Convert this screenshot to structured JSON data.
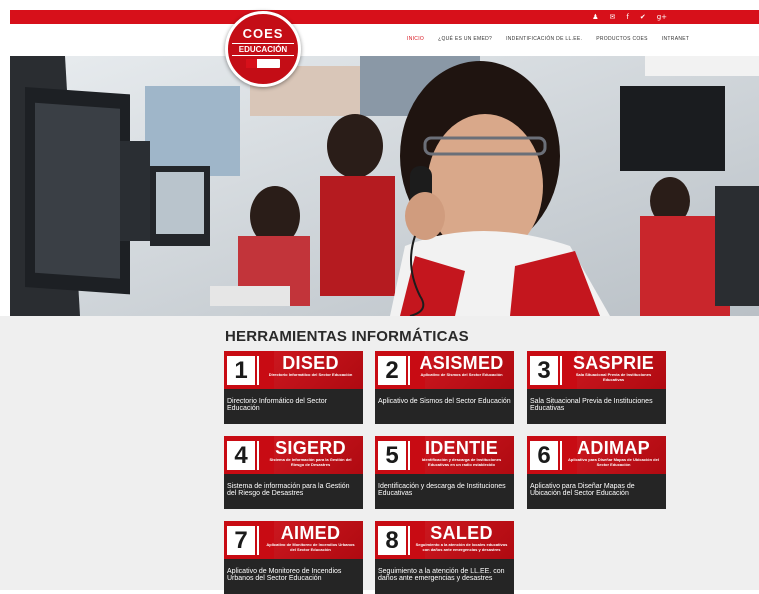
{
  "topbar": {
    "social_icons": [
      "user-icon",
      "mail-icon",
      "facebook-icon",
      "twitter-icon",
      "google-plus-icon"
    ],
    "glyphs": [
      "♟",
      "✉",
      "f",
      "✔",
      "g+"
    ]
  },
  "brand": {
    "logo_line1": "COES",
    "logo_line2": "EDUCACIÓN",
    "accent": "#d7101a"
  },
  "nav": [
    {
      "label": "INICIO",
      "active": true
    },
    {
      "label": "¿QUÉ ES UN EMED?",
      "active": false
    },
    {
      "label": "INDENTIFICACIÓN DE LL.EE.",
      "active": false
    },
    {
      "label": "PRODUCTOS COES",
      "active": false
    },
    {
      "label": "INTRANET",
      "active": false
    }
  ],
  "tools": {
    "title": "HERRAMIENTAS INFORMÁTICAS",
    "cards": [
      {
        "number": "1",
        "abbr": "DISED",
        "subtitle": "Directorio Informático del Sector Educación",
        "description": "Directorio Informático del Sector Educación"
      },
      {
        "number": "2",
        "abbr": "ASISMED",
        "subtitle": "Aplicativo de Sismos del Sector Educación",
        "description": "Aplicativo de Sismos del Sector Educación"
      },
      {
        "number": "3",
        "abbr": "SASPRIE",
        "subtitle": "Sala Situacional Previa de Instituciones Educativas",
        "description": "Sala Situacional Previa de Instituciones Educativas"
      },
      {
        "number": "4",
        "abbr": "SIGERD",
        "subtitle": "Sistema de Información para la Gestión del Riesgo de Desastres",
        "description": "Sistema de información para la Gestión del Riesgo de Desastres"
      },
      {
        "number": "5",
        "abbr": "IDENTIE",
        "subtitle": "Identificación y descarga de Instituciones Educativas en un radio establecido",
        "description": "Identificación y descarga de Instituciones Educativas"
      },
      {
        "number": "6",
        "abbr": "ADIMAP",
        "subtitle": "Aplicativo para Diseñar Mapas de Ubicación del Sector Educación",
        "description": "Aplicativo para Diseñar Mapas de Ubicación del Sector Educación"
      },
      {
        "number": "7",
        "abbr": "AIMED",
        "subtitle": "Aplicativo de Monitoreo de Incendios Urbanos del Sector Educación",
        "description": "Aplicativo de Monitoreo de Incendios Urbanos del Sector Educación"
      },
      {
        "number": "8",
        "abbr": "SALED",
        "subtitle": "Seguimiento a la atención de locales educativos con daños ante emergencias y desastres",
        "description": "Seguimiento a la atención de LL.EE. con daños ante emergencias y desastres"
      }
    ]
  }
}
